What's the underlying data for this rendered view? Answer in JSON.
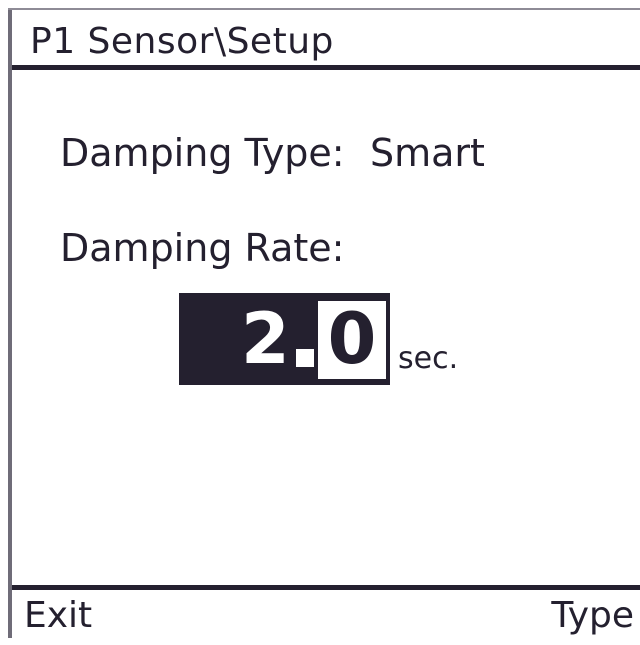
{
  "header": {
    "title": "P1 Sensor\\Setup"
  },
  "damping_type": {
    "label": "Damping Type:",
    "value": "Smart"
  },
  "damping_rate": {
    "label": "Damping Rate:",
    "value_integer": "2",
    "value_fraction": "0",
    "unit": "sec."
  },
  "softkeys": {
    "left": "Exit",
    "right": "Type"
  },
  "colors": {
    "foreground": "#24202f",
    "background": "#ffffff"
  }
}
